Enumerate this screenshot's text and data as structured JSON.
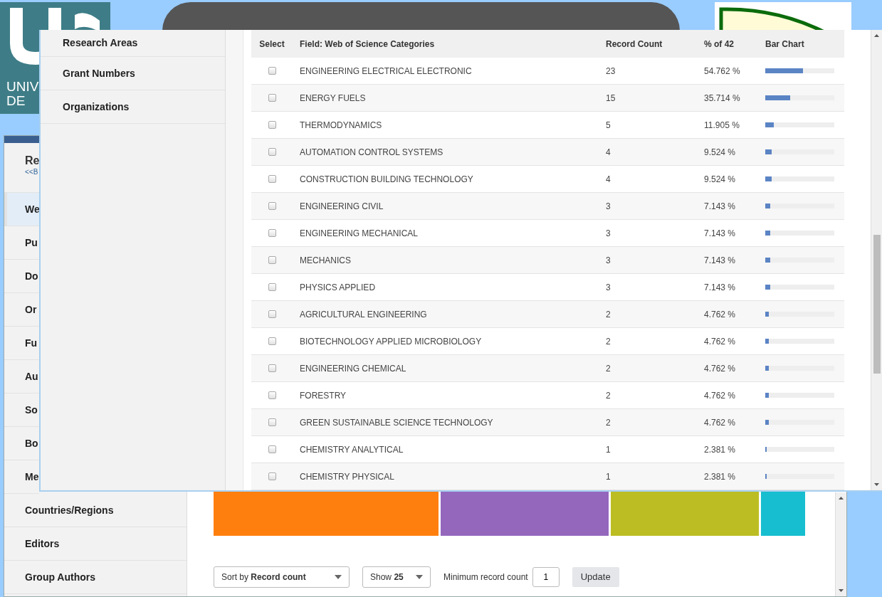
{
  "slide": {
    "logo_text": [
      "UNIV",
      "DE"
    ]
  },
  "back_window": {
    "sidebar": {
      "heading": "Re",
      "back_link": "<<B",
      "items": [
        {
          "label": "We",
          "selected": true
        },
        {
          "label": "Pu",
          "selected": false
        },
        {
          "label": "Do",
          "selected": false
        },
        {
          "label": "Or",
          "selected": false
        },
        {
          "label": "Fu",
          "selected": false
        },
        {
          "label": "Au",
          "selected": false
        },
        {
          "label": "So",
          "selected": false
        },
        {
          "label": "Bo",
          "selected": false
        },
        {
          "label": "Me",
          "selected": false
        },
        {
          "label": "Countries/Regions",
          "selected": false
        },
        {
          "label": "Editors",
          "selected": false
        },
        {
          "label": "Group Authors",
          "selected": false
        }
      ]
    },
    "treemap": [
      {
        "color": "#ff7f0e"
      },
      {
        "color": "#9467bd"
      },
      {
        "color": "#bcbd22"
      },
      {
        "color": "#17becf"
      }
    ],
    "controls": {
      "sort": {
        "prefix": "Sort by",
        "value": "Record count"
      },
      "show": {
        "prefix": "Show",
        "value": "25"
      },
      "min_label": "Minimum record count",
      "min_value": "1",
      "update": "Update"
    }
  },
  "front_window": {
    "sidebar": {
      "items": [
        "Research Areas",
        "Grant Numbers",
        "Organizations"
      ]
    },
    "table": {
      "columns": [
        "Select",
        "Field: Web of Science Categories",
        "Record Count",
        "% of 42",
        "Bar Chart"
      ],
      "rows": [
        {
          "checked": false,
          "field": "ENGINEERING ELECTRICAL ELECTRONIC",
          "count": "23",
          "percent": "54.762 %",
          "level": 0.54762
        },
        {
          "checked": false,
          "field": "ENERGY FUELS",
          "count": "15",
          "percent": "35.714 %",
          "level": 0.35714
        },
        {
          "checked": false,
          "field": "THERMODYNAMICS",
          "count": "5",
          "percent": "11.905 %",
          "level": 0.11905
        },
        {
          "checked": false,
          "field": "AUTOMATION CONTROL SYSTEMS",
          "count": "4",
          "percent": "9.524 %",
          "level": 0.09524
        },
        {
          "checked": false,
          "field": "CONSTRUCTION BUILDING TECHNOLOGY",
          "count": "4",
          "percent": "9.524 %",
          "level": 0.09524
        },
        {
          "checked": false,
          "field": "ENGINEERING CIVIL",
          "count": "3",
          "percent": "7.143 %",
          "level": 0.07143
        },
        {
          "checked": false,
          "field": "ENGINEERING MECHANICAL",
          "count": "3",
          "percent": "7.143 %",
          "level": 0.07143
        },
        {
          "checked": false,
          "field": "MECHANICS",
          "count": "3",
          "percent": "7.143 %",
          "level": 0.07143
        },
        {
          "checked": false,
          "field": "PHYSICS APPLIED",
          "count": "3",
          "percent": "7.143 %",
          "level": 0.07143
        },
        {
          "checked": false,
          "field": "AGRICULTURAL ENGINEERING",
          "count": "2",
          "percent": "4.762 %",
          "level": 0.04762
        },
        {
          "checked": false,
          "field": "BIOTECHNOLOGY APPLIED MICROBIOLOGY",
          "count": "2",
          "percent": "4.762 %",
          "level": 0.04762
        },
        {
          "checked": false,
          "field": "ENGINEERING CHEMICAL",
          "count": "2",
          "percent": "4.762 %",
          "level": 0.04762
        },
        {
          "checked": false,
          "field": "FORESTRY",
          "count": "2",
          "percent": "4.762 %",
          "level": 0.04762
        },
        {
          "checked": false,
          "field": "GREEN SUSTAINABLE SCIENCE TECHNOLOGY",
          "count": "2",
          "percent": "4.762 %",
          "level": 0.04762
        },
        {
          "checked": false,
          "field": "CHEMISTRY ANALYTICAL",
          "count": "1",
          "percent": "2.381 %",
          "level": 0.02381
        },
        {
          "checked": false,
          "field": "CHEMISTRY PHYSICAL",
          "count": "1",
          "percent": "2.381 %",
          "level": 0.02381
        }
      ]
    }
  }
}
